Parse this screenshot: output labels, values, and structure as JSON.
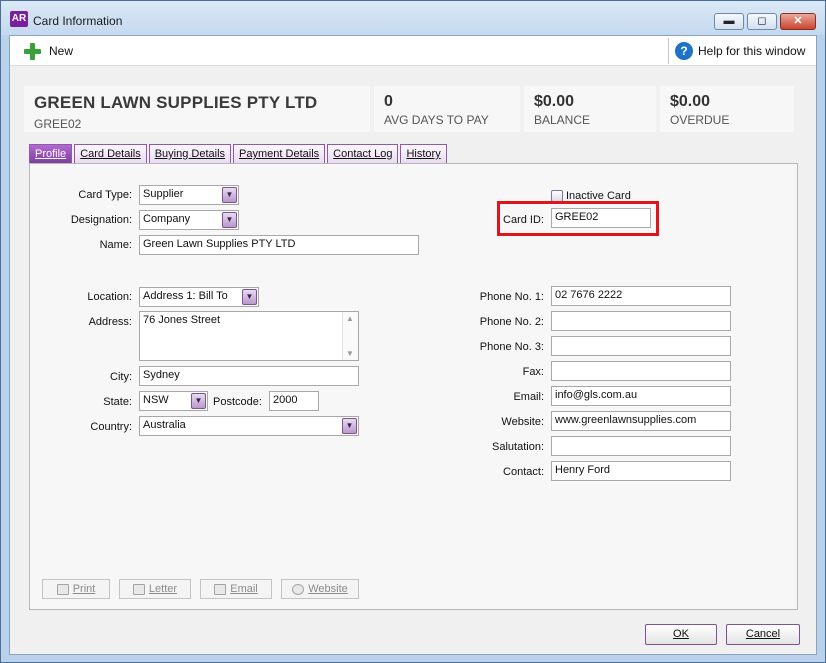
{
  "window": {
    "app_icon": "AR",
    "title": "Card Information",
    "controls": {
      "minimize": "▬",
      "maximize": "◻",
      "close": "✕"
    }
  },
  "toolbar": {
    "new_label": "New",
    "help_label": "Help for this window",
    "help_icon_glyph": "?",
    "new_icon": "plus-icon"
  },
  "summary": {
    "name": "GREEN LAWN SUPPLIES PTY LTD",
    "id": "GREE02",
    "avg_days_value": "0",
    "avg_days_label": "AVG DAYS TO PAY",
    "balance_value": "$0.00",
    "balance_label": "BALANCE",
    "overdue_value": "$0.00",
    "overdue_label": "OVERDUE"
  },
  "tabs": [
    {
      "label": "Profile",
      "active": true
    },
    {
      "label": "Card Details",
      "active": false
    },
    {
      "label": "Buying Details",
      "active": false
    },
    {
      "label": "Payment Details",
      "active": false
    },
    {
      "label": "Contact Log",
      "active": false
    },
    {
      "label": "History",
      "active": false
    }
  ],
  "profile": {
    "card_type_label": "Card Type:",
    "card_type_value": "Supplier",
    "designation_label": "Designation:",
    "designation_value": "Company",
    "name_label": "Name:",
    "name_value": "Green Lawn Supplies PTY LTD",
    "inactive_label": "Inactive Card",
    "card_id_label": "Card ID:",
    "card_id_value": "GREE02",
    "location_label": "Location:",
    "location_value": "Address 1: Bill To",
    "address_label": "Address:",
    "address_value": "76 Jones Street",
    "city_label": "City:",
    "city_value": "Sydney",
    "state_label": "State:",
    "state_value": "NSW",
    "postcode_label": "Postcode:",
    "postcode_value": "2000",
    "country_label": "Country:",
    "country_value": "Australia",
    "phone1_label": "Phone No. 1:",
    "phone1_value": "02 7676 2222",
    "phone2_label": "Phone No. 2:",
    "phone2_value": "",
    "phone3_label": "Phone No. 3:",
    "phone3_value": "",
    "fax_label": "Fax:",
    "fax_value": "",
    "email_label": "Email:",
    "email_value": "info@gls.com.au",
    "website_label": "Website:",
    "website_value": "www.greenlawnsupplies.com",
    "salutation_label": "Salutation:",
    "salutation_value": "",
    "contact_label": "Contact:",
    "contact_value": "Henry Ford"
  },
  "actions": {
    "print": "Print",
    "letter": "Letter",
    "email": "Email",
    "website": "Website"
  },
  "dialog": {
    "ok": "OK",
    "cancel": "Cancel"
  },
  "colors": {
    "accent_purple": "#7f3da0",
    "highlight_red": "#e0141c",
    "help_blue": "#1f73c7",
    "new_green": "#3aa13a"
  }
}
